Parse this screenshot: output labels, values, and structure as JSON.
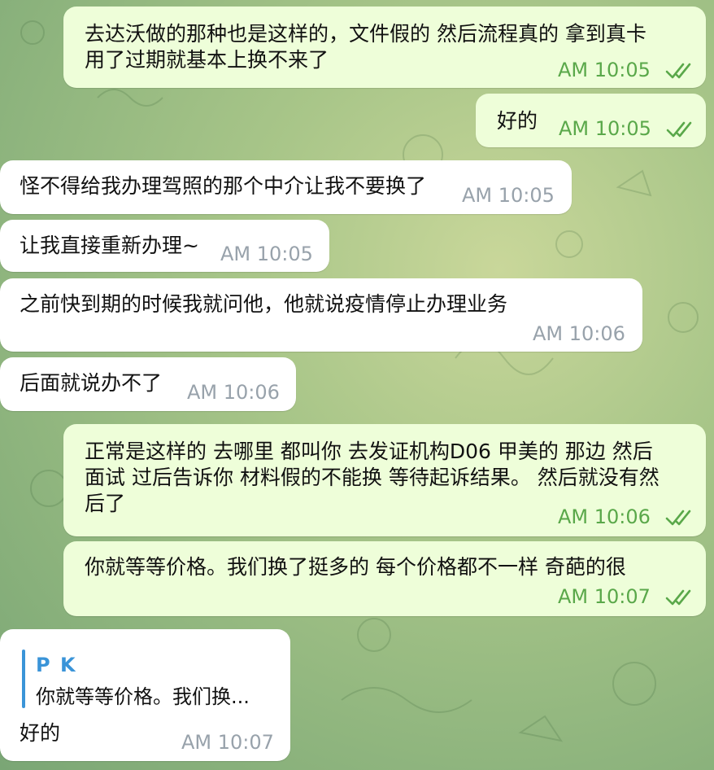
{
  "colors": {
    "incoming_bubble": "#ffffff",
    "outgoing_bubble": "#eefed9",
    "outgoing_time": "#5aa84a",
    "incoming_time": "#98a2ab",
    "reply_accent": "#3a94d8"
  },
  "messages": [
    {
      "direction": "outgoing",
      "text": "去达沃做的那种也是这样的，文件假的 然后流程真的 拿到真卡\n用了过期就基本上换不来了",
      "time": "AM 10:05",
      "status": "read"
    },
    {
      "direction": "outgoing",
      "text": "好的",
      "time": "AM 10:05",
      "status": "read"
    },
    {
      "direction": "incoming",
      "text": "怪不得给我办理驾照的那个中介让我不要换了",
      "time": "AM 10:05"
    },
    {
      "direction": "incoming",
      "text": "让我直接重新办理~",
      "time": "AM 10:05"
    },
    {
      "direction": "incoming",
      "text": "之前快到期的时候我就问他，他就说疫情停止办理业务",
      "time": "AM 10:06"
    },
    {
      "direction": "incoming",
      "text": "后面就说办不了",
      "time": "AM 10:06"
    },
    {
      "direction": "outgoing",
      "text": "正常是这样的 去哪里 都叫你 去发证机构D06 甲美的 那边 然后\n面试 过后告诉你 材料假的不能换 等待起诉结果。 然后就没有然\n后了",
      "time": "AM 10:06",
      "status": "read"
    },
    {
      "direction": "outgoing",
      "text": "你就等等价格。我们换了挺多的 每个价格都不一样 奇葩的很",
      "time": "AM 10:07",
      "status": "read"
    },
    {
      "direction": "incoming",
      "text": "好的",
      "time": "AM 10:07",
      "reply": {
        "author": "P K",
        "snippet": "你就等等价格。我们换..."
      }
    }
  ]
}
